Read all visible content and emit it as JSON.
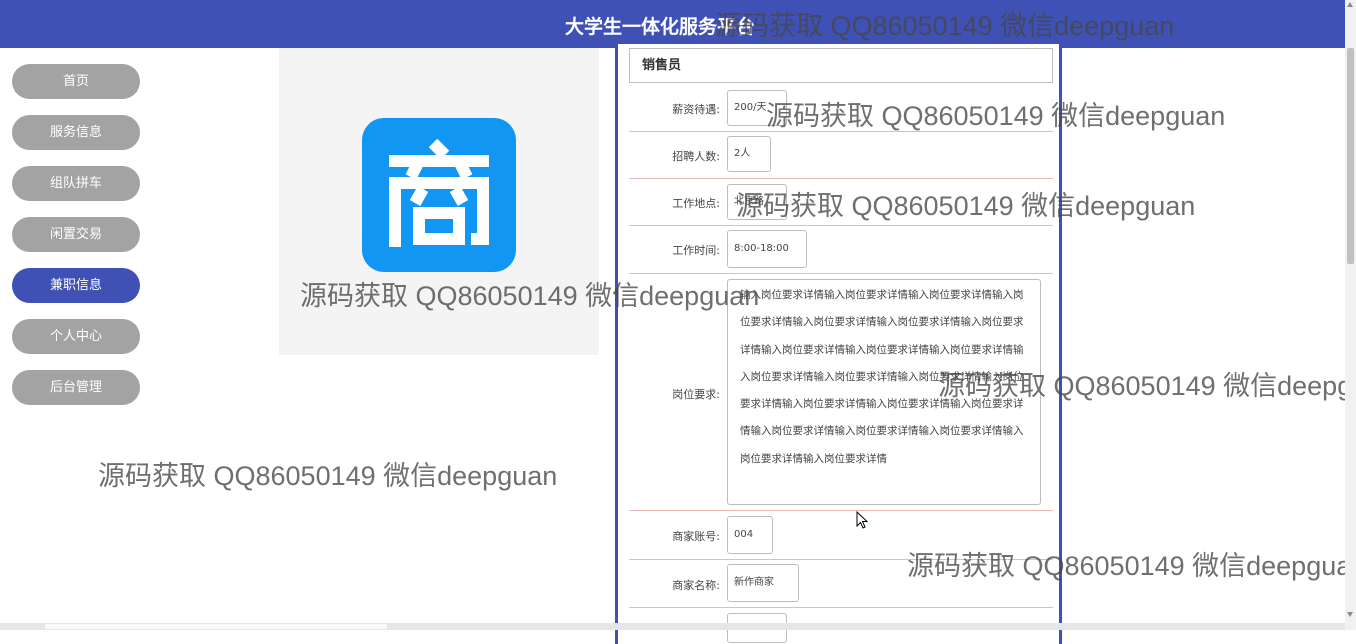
{
  "header": {
    "title": "大学生一体化服务平台"
  },
  "nav": {
    "items": [
      {
        "label": "首页",
        "active": false
      },
      {
        "label": "服务信息",
        "active": false
      },
      {
        "label": "组队拼车",
        "active": false
      },
      {
        "label": "闲置交易",
        "active": false
      },
      {
        "label": "兼职信息",
        "active": true
      },
      {
        "label": "个人中心",
        "active": false
      },
      {
        "label": "后台管理",
        "active": false
      }
    ]
  },
  "logo": {
    "glyph": "商",
    "color": "#1296f3",
    "icon": "shop-logo-icon"
  },
  "job": {
    "title": "销售员",
    "salary": {
      "label": "薪资待遇:",
      "value": "200/天"
    },
    "headcount": {
      "label": "招聘人数:",
      "value": "2人"
    },
    "location": {
      "label": "工作地点:",
      "value": "北京路"
    },
    "hours": {
      "label": "工作时间:",
      "value": "8:00-18:00"
    },
    "requirements": {
      "label": "岗位要求:",
      "value": "输入岗位要求详情输入岗位要求详情输入岗位要求详情输入岗位要求详情输入岗位要求详情输入岗位要求详情输入岗位要求详情输入岗位要求详情输入岗位要求详情输入岗位要求详情输入岗位要求详情输入岗位要求详情输入岗位要求详情输入岗位要求详情输入岗位要求详情输入岗位要求详情输入岗位要求详情输入岗位要求详情输入岗位要求详情输入岗位要求详情输入岗位要求详情输入岗位要求详情"
    },
    "merchant_account": {
      "label": "商家账号:",
      "value": "004"
    },
    "merchant_name": {
      "label": "商家名称:",
      "value": "新作商家"
    }
  },
  "watermark": "源码获取 QQ86050149 微信deepguan",
  "colors": {
    "primary": "#3f51b5",
    "nav_inactive": "#a3a3a3",
    "row_divider": "#e9b9b9"
  }
}
